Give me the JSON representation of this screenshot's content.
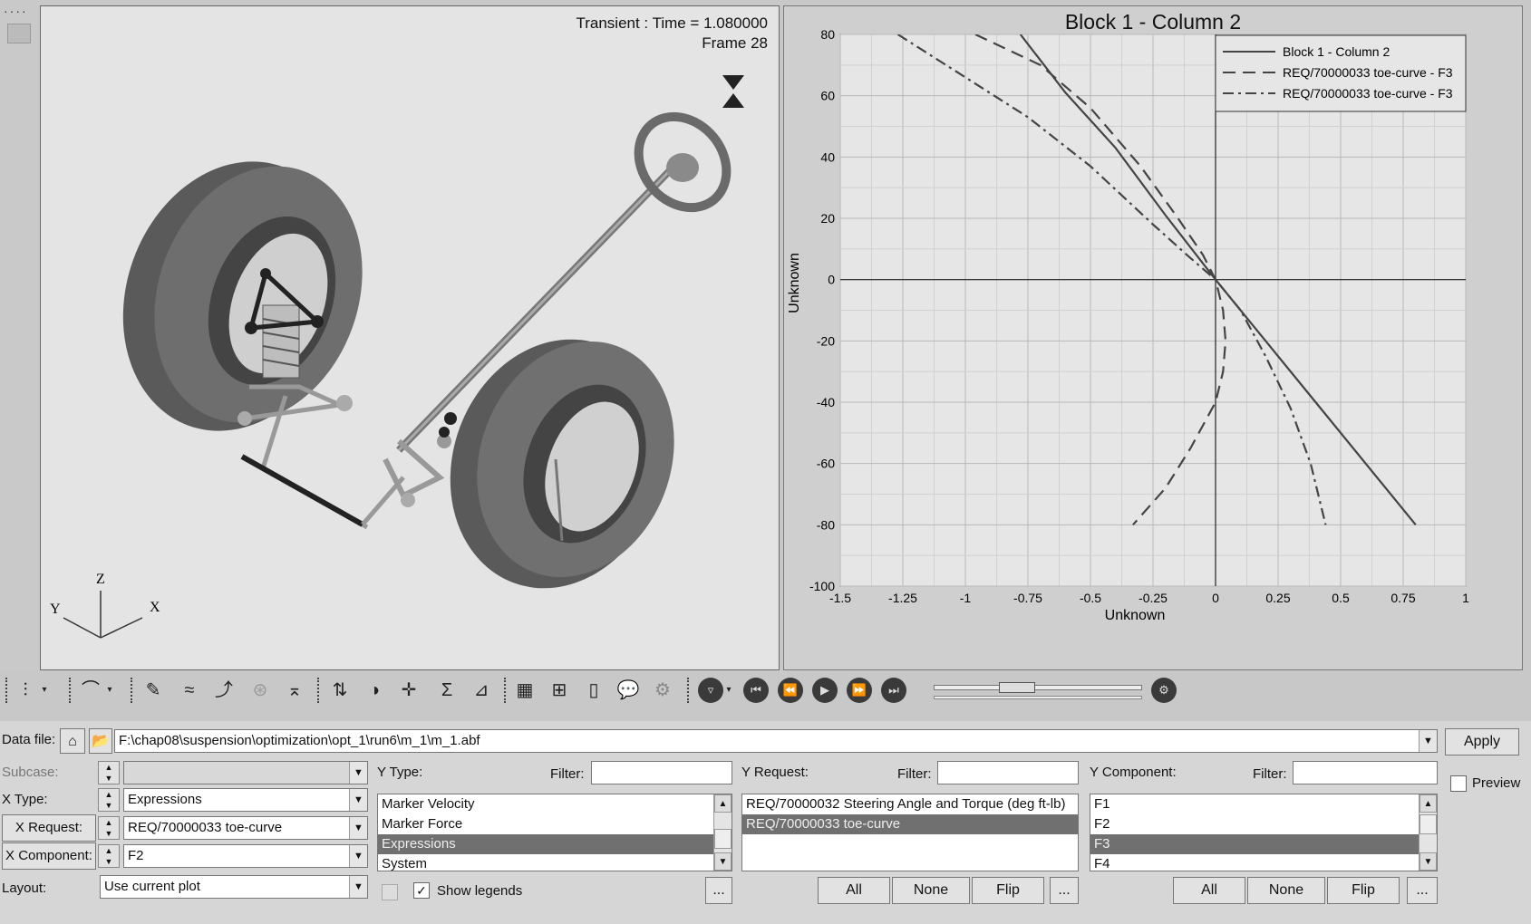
{
  "viewport": {
    "transient_line": "Transient : Time = 1.080000",
    "frame_line": "Frame 28",
    "axis_z": "Z",
    "axis_y": "Y",
    "axis_x": "X"
  },
  "chart_data": {
    "type": "line",
    "title": "Block 1 - Column 2",
    "xlabel": "Unknown",
    "ylabel": "Unknown",
    "xlim": [
      -1.5,
      1
    ],
    "ylim": [
      -100,
      80
    ],
    "xticks": [
      "-1.5",
      "-1.25",
      "-1",
      "-0.75",
      "-0.5",
      "-0.25",
      "0",
      "0.25",
      "0.5",
      "0.75",
      "1"
    ],
    "yticks": [
      "80",
      "60",
      "40",
      "20",
      "0",
      "-20",
      "-40",
      "-60",
      "-80",
      "-100"
    ],
    "grid": true,
    "legend_position": "top-right",
    "series": [
      {
        "name": "Block 1 - Column 2",
        "style": "solid",
        "x": [
          -0.78,
          -0.6,
          -0.4,
          -0.2,
          0,
          0.2,
          0.4,
          0.6,
          0.8
        ],
        "y": [
          80,
          61,
          43,
          21,
          0,
          -20,
          -40,
          -60,
          -80
        ]
      },
      {
        "name": "REQ/70000033 toe-curve - F3",
        "style": "dash",
        "x": [
          -0.96,
          -0.7,
          -0.5,
          -0.3,
          -0.15,
          -0.05,
          0,
          0.03,
          0.04,
          0.03,
          0,
          -0.1,
          -0.2,
          -0.33
        ],
        "y": [
          80,
          70,
          56,
          37,
          20,
          8,
          0,
          -10,
          -20,
          -30,
          -40,
          -55,
          -68,
          -80
        ]
      },
      {
        "name": "REQ/70000033 toe-curve - F3",
        "style": "dashdot",
        "x": [
          -1.27,
          -1.0,
          -0.75,
          -0.5,
          -0.25,
          -0.1,
          0,
          0.1,
          0.2,
          0.3,
          0.38,
          0.44
        ],
        "y": [
          80,
          66,
          53,
          37,
          18,
          7,
          0,
          -10,
          -25,
          -42,
          -60,
          -80
        ]
      }
    ]
  },
  "toolbar": {
    "icons": [
      "plot-type-icon",
      "curve-icon",
      "edit-curve-icon",
      "math-curve-icon",
      "add-curve-icon",
      "disabled-icon",
      "baseline-icon",
      "derivative-icon",
      "color-icon",
      "crosshair-icon",
      "sum-icon",
      "fit-icon",
      "grid-icon",
      "table-icon",
      "page-icon",
      "note-icon",
      "settings-icon",
      "record-icon",
      "first-frame-icon",
      "step-back-icon",
      "play-icon",
      "step-forward-icon",
      "last-frame-icon",
      "animation-settings-icon"
    ]
  },
  "panel": {
    "data_file_label": "Data file:",
    "data_file_value": "F:\\chap08\\suspension\\optimization\\opt_1\\run6\\m_1\\m_1.abf",
    "apply": "Apply",
    "preview": "Preview",
    "subcase_label": "Subcase:",
    "x_type_label": "X Type:",
    "x_type_value": "Expressions",
    "x_request_label": "X Request:",
    "x_request_value": "REQ/70000033 toe-curve",
    "x_component_label": "X Component:",
    "x_component_value": "F2",
    "layout_label": "Layout:",
    "layout_value": "Use current plot",
    "y_type_label": "Y Type:",
    "y_request_label": "Y Request:",
    "y_component_label": "Y Component:",
    "filter_label": "Filter:",
    "show_legends": "Show legends",
    "y_type_items": [
      "Marker Velocity",
      "Marker Force",
      "Expressions",
      "System"
    ],
    "y_type_selected": 2,
    "y_request_items": [
      "REQ/70000032 Steering Angle and Torque (deg ft-lb)",
      "REQ/70000033 toe-curve"
    ],
    "y_request_selected": 1,
    "y_component_items": [
      "F1",
      "F2",
      "F3",
      "F4"
    ],
    "y_component_selected": 2,
    "all": "All",
    "none": "None",
    "flip": "Flip",
    "more": "..."
  }
}
